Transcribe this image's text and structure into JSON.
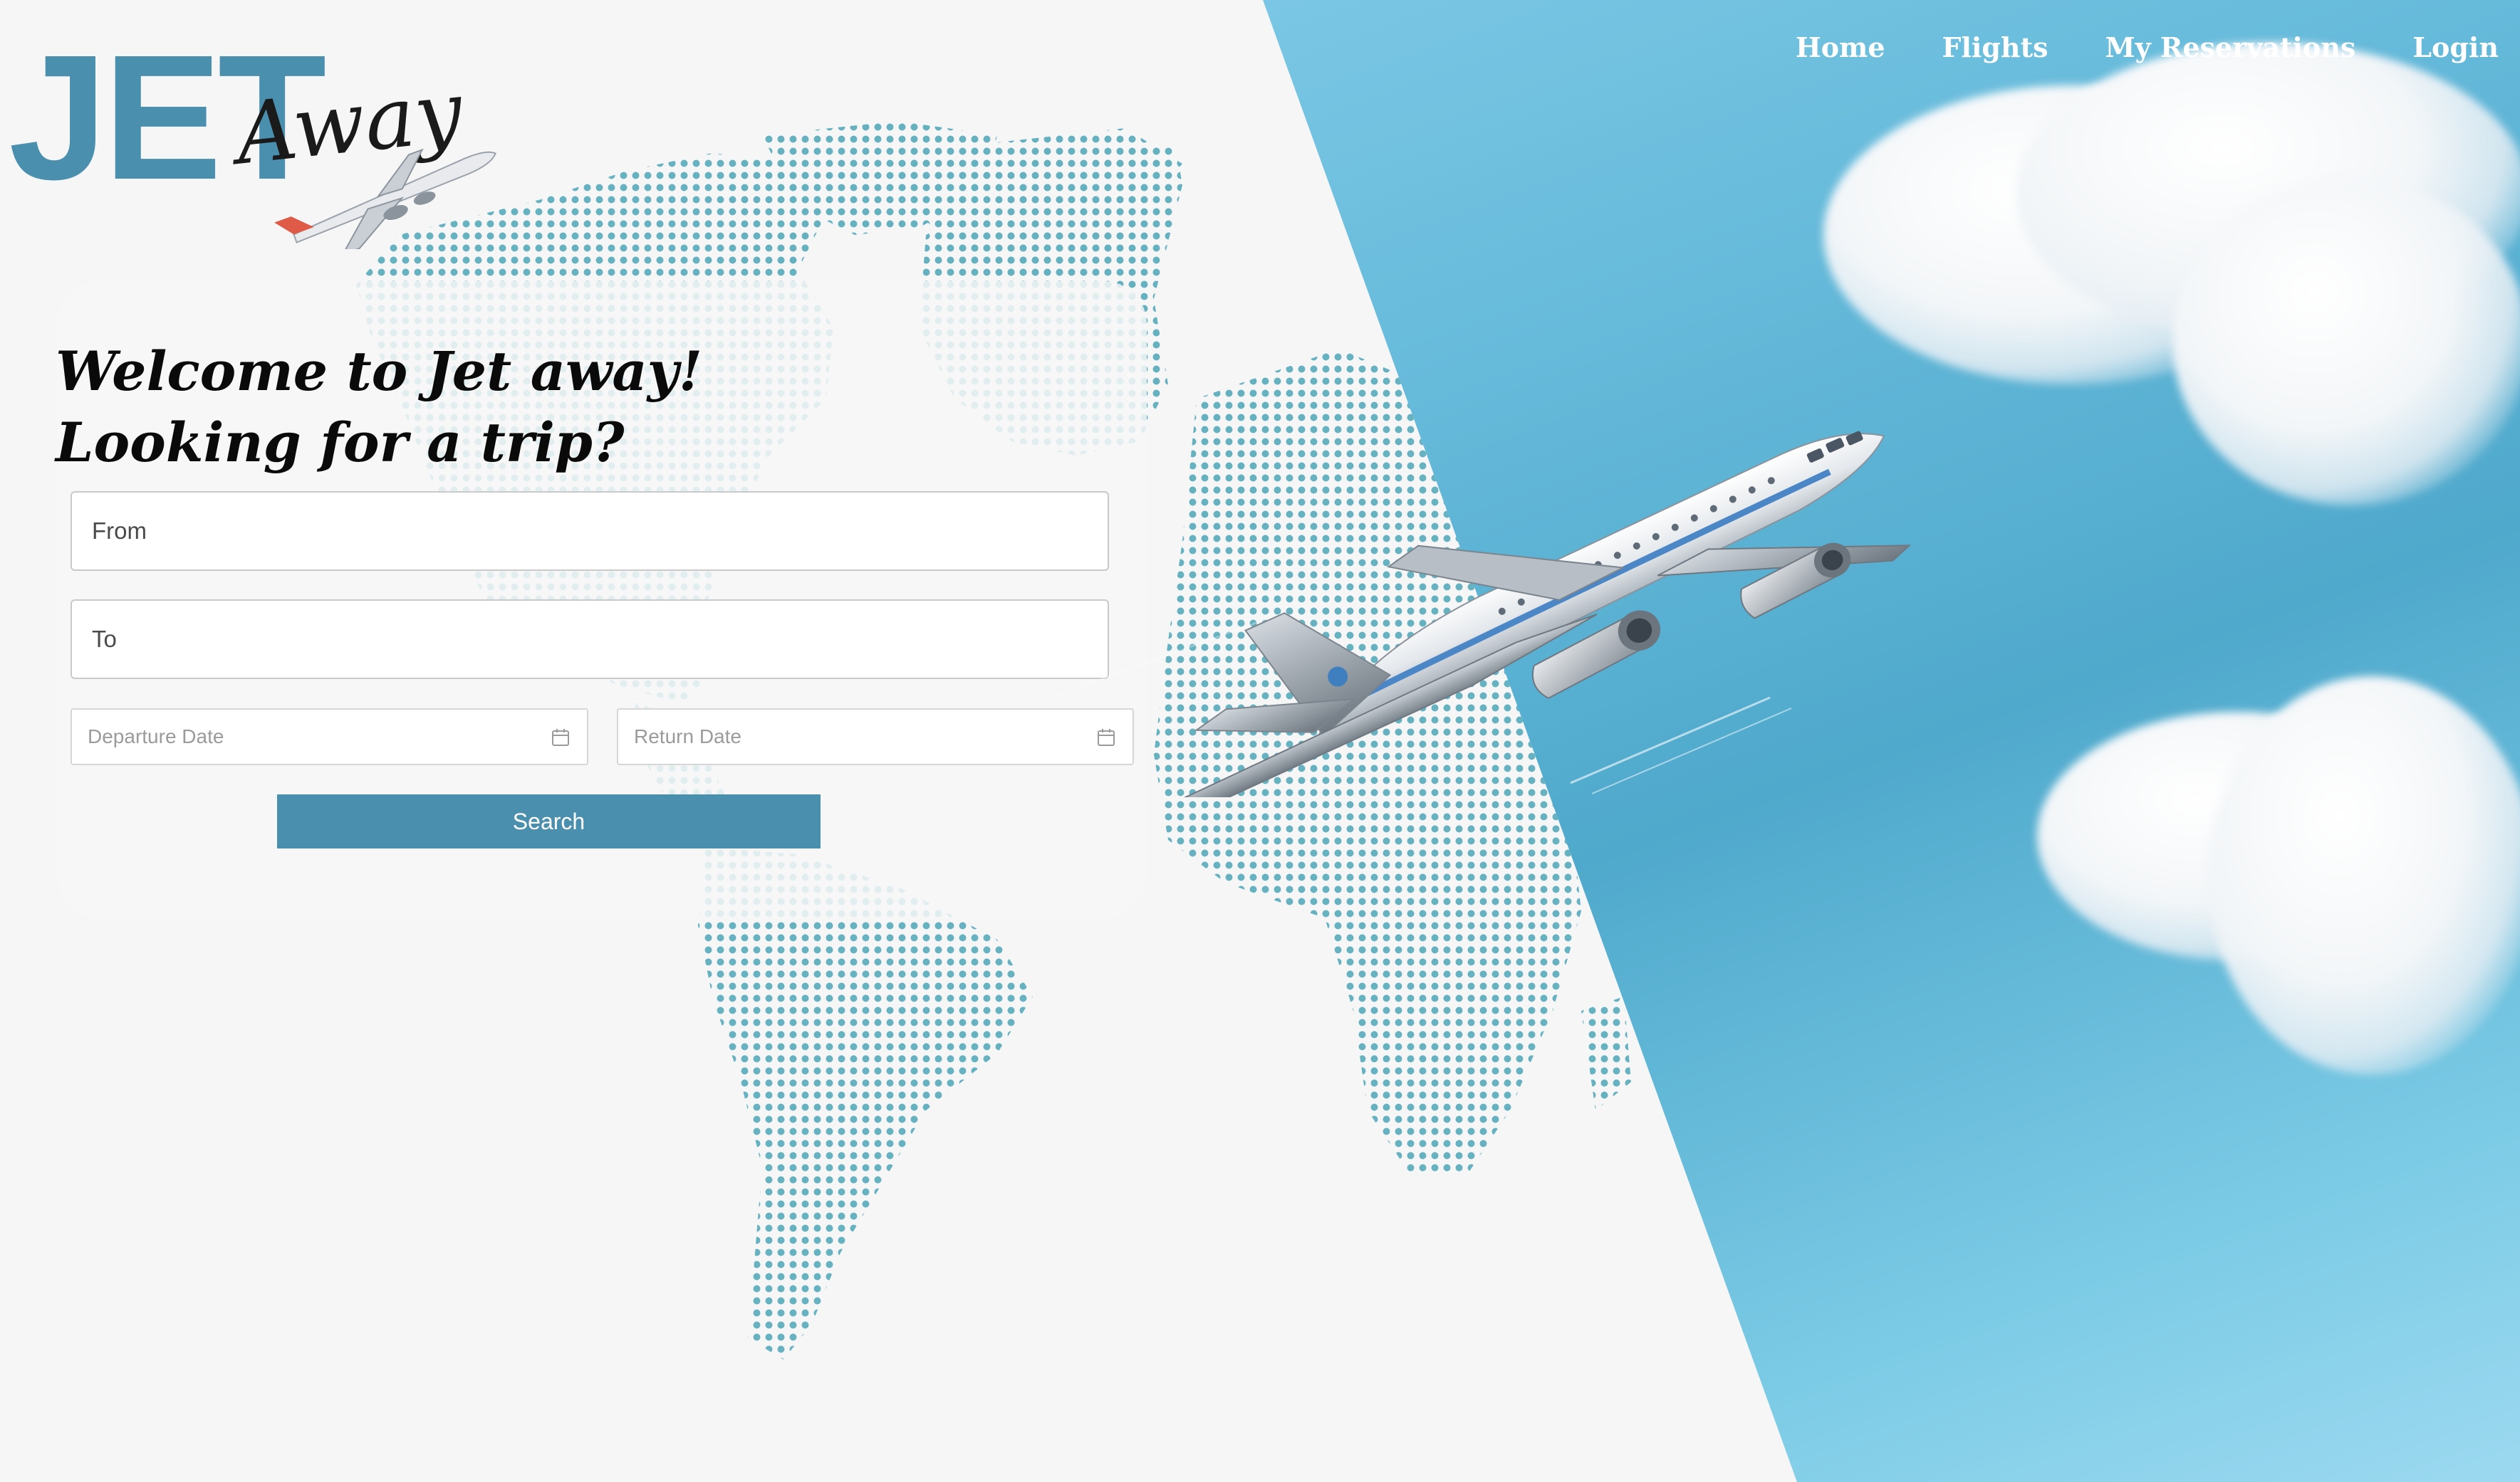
{
  "brand": {
    "logo_main": "JET",
    "logo_script": "Away"
  },
  "nav": {
    "items": [
      "Home",
      "Flights",
      "My Reservations",
      "Login"
    ]
  },
  "hero": {
    "line1": "Welcome to Jet away!",
    "line2": "Looking for a trip?"
  },
  "search": {
    "from_placeholder": "From",
    "to_placeholder": "To",
    "departure_placeholder": "Departure Date",
    "return_placeholder": "Return Date",
    "button_label": "Search"
  },
  "colors": {
    "brand": "#4a8fae",
    "sky": "#6cc0e0",
    "page_bg": "#f6f6f7"
  },
  "icons": {
    "calendar": "calendar-icon",
    "plane": "airplane-illustration"
  }
}
